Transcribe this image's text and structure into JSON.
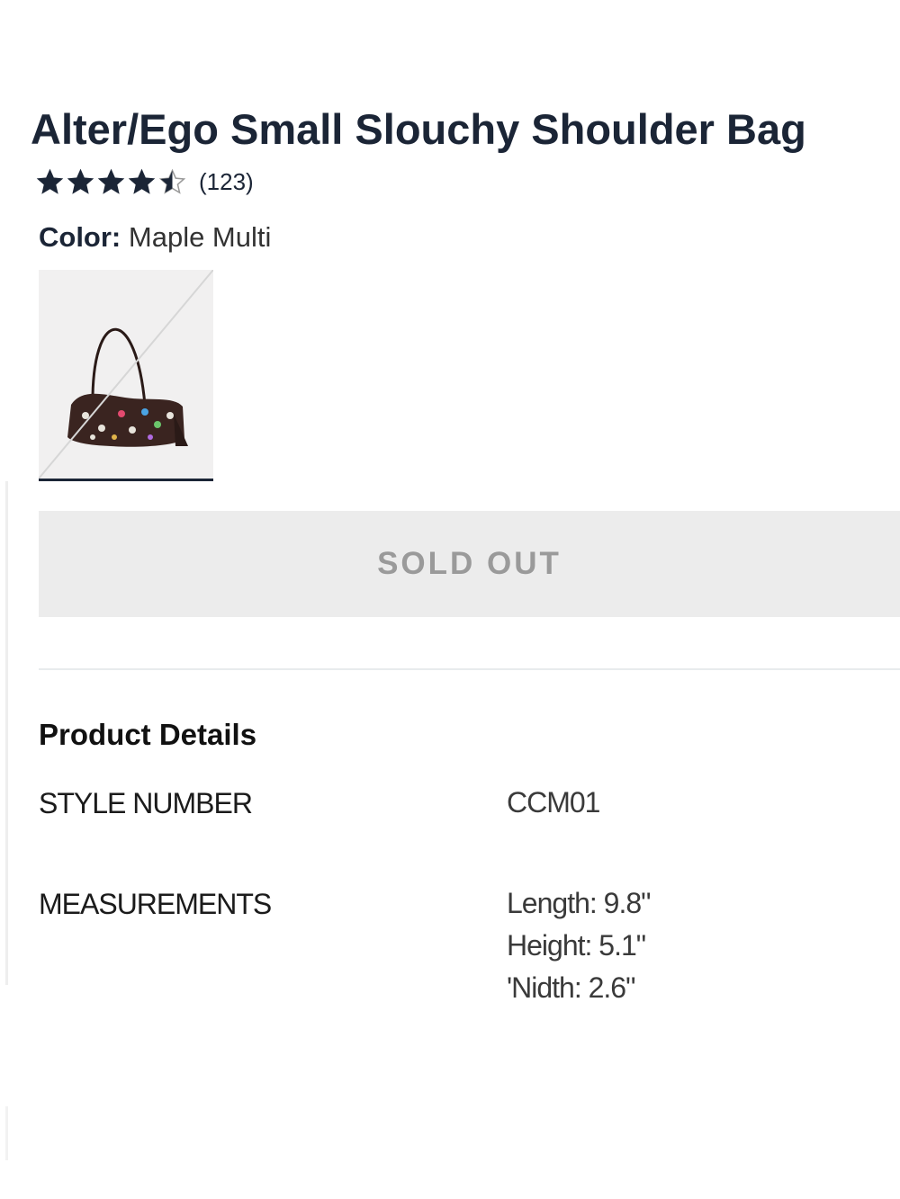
{
  "product": {
    "title": "Alter/Ego Small Slouchy Shoulder Bag",
    "rating": {
      "value": 4.5,
      "max": 5,
      "count_text": "(123)"
    },
    "color": {
      "label": "Color:",
      "value": "Maple Multi"
    },
    "swatch": {
      "icon": "bag-thumbnail-icon",
      "state": "selected-unavailable"
    },
    "cta": {
      "label": "SOLD OUT",
      "state": "disabled"
    }
  },
  "details": {
    "heading": "Product Details",
    "style_number": {
      "label": "STYLE NUMBER",
      "value": "CCM01"
    },
    "measurements": {
      "label": "MEASUREMENTS",
      "lines": [
        "Length: 9.8\"",
        "Height: 5.1\"",
        "'Nidth: 2.6\""
      ]
    }
  },
  "colors": {
    "title": "#1b2536",
    "star": "#1b2536",
    "button_bg": "#ececec",
    "button_text": "#9a9a9a",
    "bag_body": "#3a2420"
  }
}
